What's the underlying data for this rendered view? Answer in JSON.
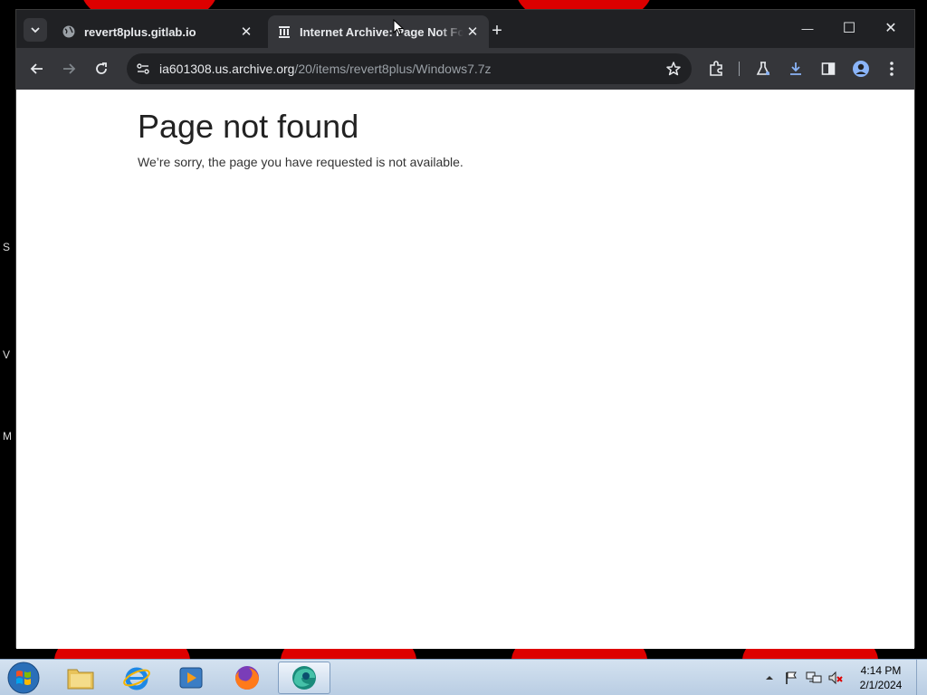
{
  "desktop": {
    "edge_letters": [
      "S",
      "V",
      "M"
    ]
  },
  "browser": {
    "tabs": [
      {
        "title": "revert8plus.gitlab.io",
        "close": "✕",
        "favicon": "globe-icon",
        "active": false
      },
      {
        "title": "Internet Archive: Page Not Found",
        "close": "✕",
        "favicon": "archive-icon",
        "active": true
      }
    ],
    "new_tab": "+",
    "window_controls": {
      "minimize": "—",
      "maximize": "☐",
      "close": "✕"
    },
    "toolbar": {
      "url_host": "ia601308.us.archive.org",
      "url_path": "/20/items/revert8plus/Windows7.7z",
      "icons": [
        "back-icon",
        "forward-icon",
        "reload-icon",
        "site-info-icon",
        "bookmark-star-icon",
        "extensions-icon",
        "labs-icon",
        "download-icon",
        "side-panel-icon",
        "profile-icon",
        "menu-icon"
      ]
    },
    "accent": "#8ab4f8"
  },
  "page": {
    "title": "Page not found",
    "message": "We’re sorry, the page you have requested is not available."
  },
  "taskbar": {
    "apps": [
      "file-explorer",
      "internet-explorer",
      "media-player",
      "firefox",
      "edge"
    ],
    "time": "4:14 PM",
    "date": "2/1/2024"
  }
}
